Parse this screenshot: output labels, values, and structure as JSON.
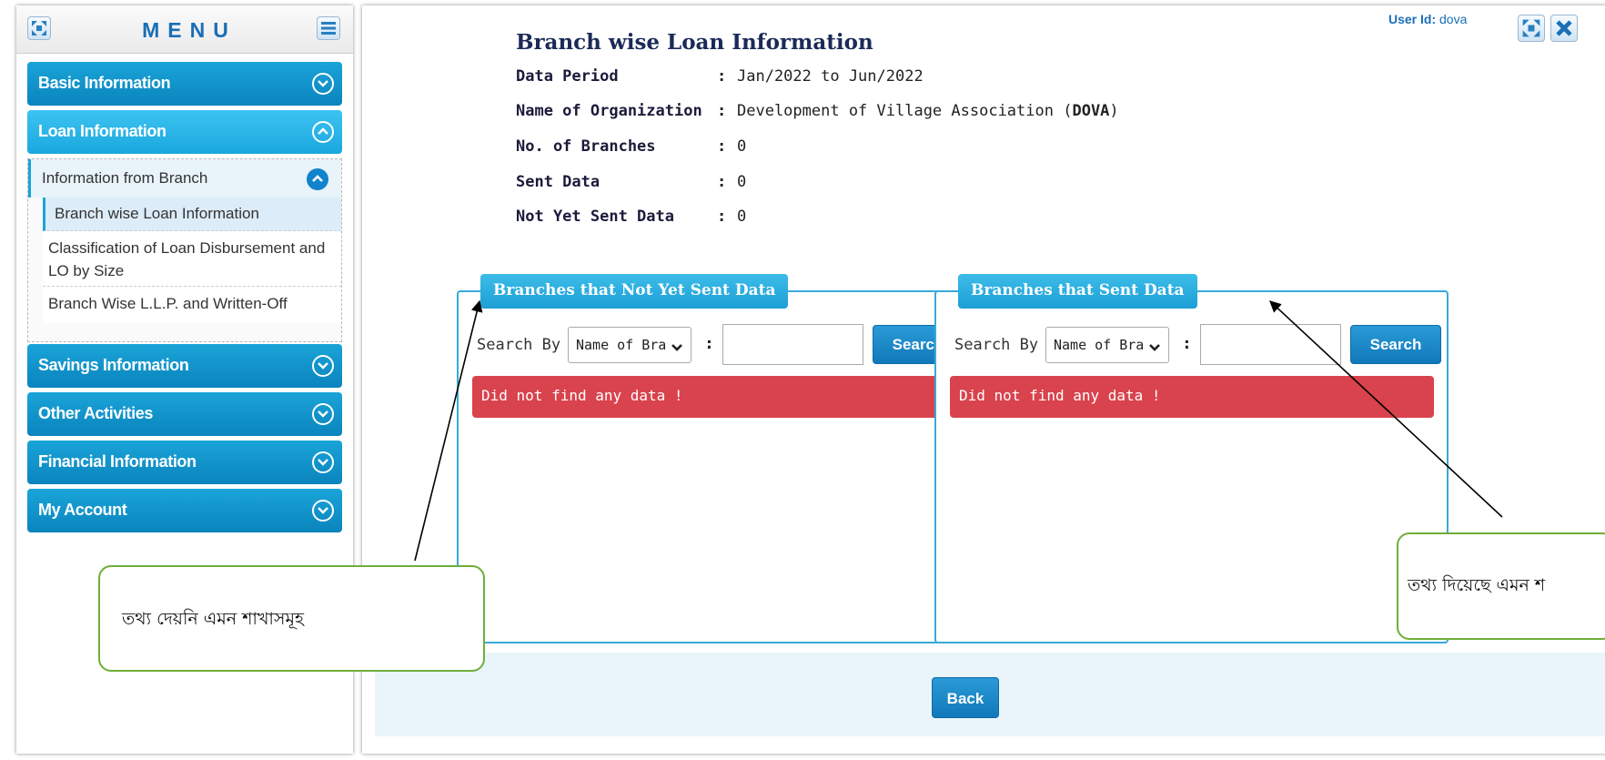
{
  "sidebar": {
    "title": "MENU",
    "items": [
      {
        "label": "Basic Information"
      },
      {
        "label": "Loan Information"
      },
      {
        "label": "Savings Information"
      },
      {
        "label": "Other Activities"
      },
      {
        "label": "Financial Information"
      },
      {
        "label": "My Account"
      }
    ],
    "submenu": {
      "parent": "Information from Branch",
      "children": [
        "Branch wise Loan Information",
        "Classification of Loan Disbursement and LO by Size",
        "Branch Wise L.L.P. and Written-Off"
      ]
    }
  },
  "header": {
    "user_label": "User Id:",
    "user_value": "dova"
  },
  "page": {
    "title": "Branch wise Loan Information",
    "info": [
      {
        "label": "Data Period",
        "value": "Jan/2022 to Jun/2022"
      },
      {
        "label": "Name of Organization",
        "value_prefix": "Development of Village Association (",
        "value_bold": "DOVA",
        "value_suffix": ")"
      },
      {
        "label": "No. of Branches",
        "value": "0"
      },
      {
        "label": "Sent Data",
        "value": "0"
      },
      {
        "label": "Not Yet Sent Data",
        "value": "0"
      }
    ],
    "colon": ":",
    "panels": [
      {
        "title": "Branches that Not Yet Sent Data",
        "search_by_label": "Search By",
        "select_value": "Name of Bra",
        "colon": ":",
        "search_value": "",
        "search_button": "Search",
        "alert": "Did not find any data !"
      },
      {
        "title": "Branches that Sent Data",
        "search_by_label": "Search By",
        "select_value": "Name of Bra",
        "colon": ":",
        "search_value": "",
        "search_button": "Search",
        "alert": "Did not find any data !"
      }
    ],
    "back_button": "Back"
  },
  "callouts": {
    "left": "তথ্য দেয়নি  এমন শাখাসমূহ",
    "right": "তথ্য দিয়েছে এমন শ"
  },
  "colors": {
    "menu_blue": "#0a84bd",
    "menu_active": "#1aa8e0",
    "alert_red": "#d9434d",
    "panel_border": "#39a9d8",
    "callout_border": "#6fae3a"
  }
}
